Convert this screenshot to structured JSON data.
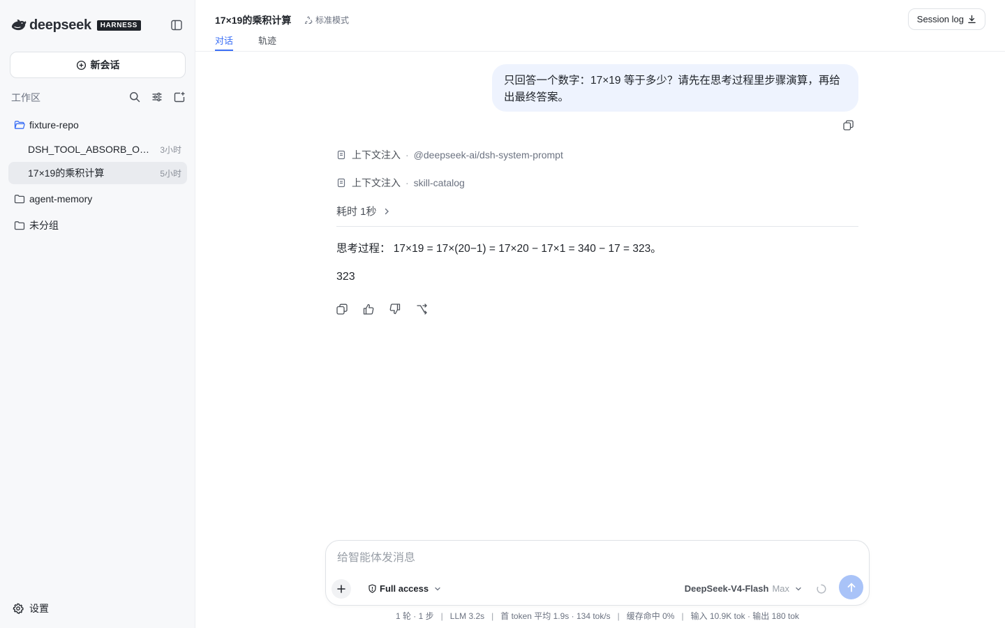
{
  "app": {
    "brand": "deepseek",
    "badge": "HARNESS"
  },
  "sidebar": {
    "new_chat_label": "新会话",
    "workspace_label": "工作区",
    "folders": [
      {
        "label": "fixture-repo"
      },
      {
        "label": "agent-memory"
      },
      {
        "label": "未分组"
      }
    ],
    "sessions": [
      {
        "label": "DSH_TOOL_ABSORB_OK ...",
        "time": "3小时"
      },
      {
        "label": "17×19的乘积计算",
        "time": "5小时"
      }
    ],
    "settings_label": "设置"
  },
  "header": {
    "title": "17×19的乘积计算",
    "mode": "标准模式",
    "tabs": [
      {
        "label": "对话"
      },
      {
        "label": "轨迹"
      }
    ],
    "session_log_label": "Session log"
  },
  "conversation": {
    "user_message": "只回答一个数字：17×19 等于多少？请先在思考过程里步骤演算，再给出最终答案。",
    "context_injections": [
      {
        "label": "上下文注入",
        "source": "@deepseek-ai/dsh-system-prompt"
      },
      {
        "label": "上下文注入",
        "source": "skill-catalog"
      }
    ],
    "duration": "耗时 1秒",
    "thought": "思考过程： 17×19 = 17×(20−1) = 17×20 − 17×1 = 340 − 17 = 323。",
    "answer": "323"
  },
  "composer": {
    "placeholder": "给智能体发消息",
    "access": "Full access",
    "model": "DeepSeek-V4-Flash",
    "effort": "Max"
  },
  "stats": {
    "rounds": "1 轮 · 1 步",
    "llm": "LLM 3.2s",
    "first_token": "首 token 平均 1.9s · 134 tok/s",
    "cache": "缓存命中 0%",
    "tokens": "输入 10.9K tok · 输出 180 tok"
  },
  "colors": {
    "accent": "#3b6ff5",
    "user_bubble": "#eef3fe",
    "sidebar_bg": "#f7f8fa",
    "send_button": "#a9c3f8"
  }
}
